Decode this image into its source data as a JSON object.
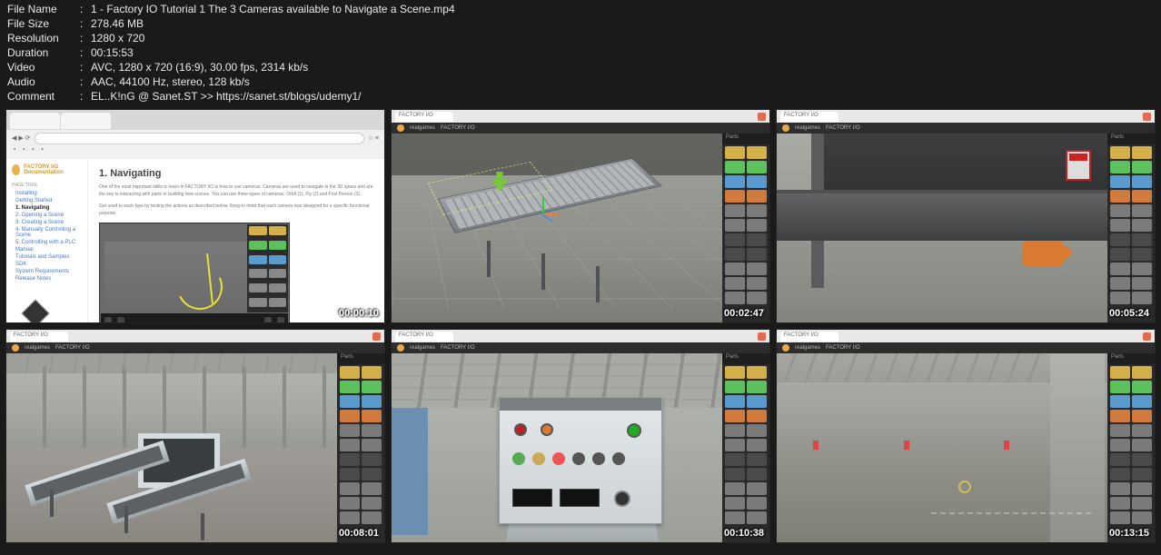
{
  "metadata": {
    "labels": {
      "file_name": "File Name",
      "file_size": "File Size",
      "resolution": "Resolution",
      "duration": "Duration",
      "video": "Video",
      "audio": "Audio",
      "comment": "Comment"
    },
    "file_name": "1 - Factory IO Tutorial 1 The 3 Cameras available to Navigate a Scene.mp4",
    "file_size": "278.46 MB",
    "resolution": "1280 x 720",
    "duration": "00:15:53",
    "video": "AVC, 1280 x 720 (16:9), 30.00 fps, 2314 kb/s",
    "audio": "AAC, 44100 Hz, stereo, 128 kb/s",
    "comment": "EL..K!nG @ Sanet.ST >> https://sanet.st/blogs/udemy1/"
  },
  "thumbs": [
    {
      "time": "00:00:10"
    },
    {
      "time": "00:02:47"
    },
    {
      "time": "00:05:24"
    },
    {
      "time": "00:08:01"
    },
    {
      "time": "00:10:38"
    },
    {
      "time": "00:13:15"
    }
  ],
  "docs": {
    "brand": "FACTORY I/O Documentation",
    "page_tree_label": "PAGE TREE",
    "nav": {
      "installing": "Installing",
      "getting_started": "Getting Started",
      "navigating": "1. Navigating",
      "opening": "2. Opening a Scene",
      "creating": "3. Creating a Scene",
      "manually": "4. Manually Controlling a Scene",
      "controlling": "5. Controlling with a PLC",
      "manual": "Manual",
      "tutorials": "Tutorials and Samples",
      "sdk": "SDK",
      "sysreq": "System Requirements",
      "release": "Release Notes"
    },
    "h1": "1. Navigating",
    "p1": "One of the most important skills to learn in FACTORY I/O is how to use cameras. Cameras are used to navigate in the 3D space and are the key to interacting with parts or building new scenes. You can use three types of cameras: Orbit (1), Fly (2) and First Person (3).",
    "p2": "Get used to each type by testing the actions as described below. Keep in mind that each camera was designed for a specific functional purpose."
  },
  "fio": {
    "brand": "realgames",
    "title": "FACTORY I/O",
    "panel_header": "Parts"
  }
}
